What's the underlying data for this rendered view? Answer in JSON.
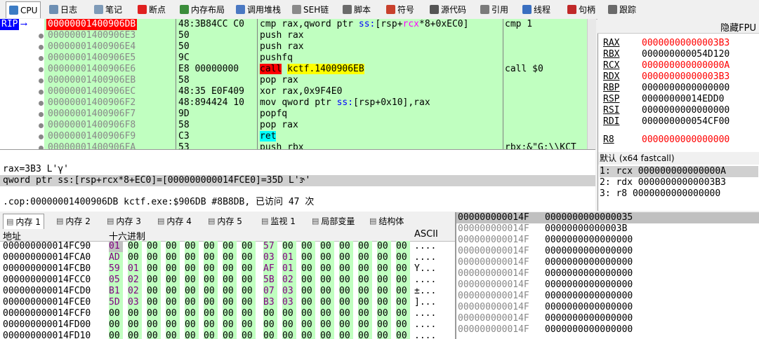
{
  "tabs": [
    {
      "label": "CPU",
      "icon": "cpu-icon",
      "color": "#3c7cc4"
    },
    {
      "label": "日志",
      "icon": "log-icon",
      "color": "#6d8fb3"
    },
    {
      "label": "笔记",
      "icon": "notes-icon",
      "color": "#7f9bb8"
    },
    {
      "label": "断点",
      "icon": "breakpoint-icon",
      "color": "#e02020"
    },
    {
      "label": "内存布局",
      "icon": "memory-map-icon",
      "color": "#3b8d3b"
    },
    {
      "label": "调用堆栈",
      "icon": "callstack-icon",
      "color": "#4a78c2"
    },
    {
      "label": "SEH链",
      "icon": "seh-icon",
      "color": "#8a8a8a"
    },
    {
      "label": "脚本",
      "icon": "script-icon",
      "color": "#6b6b6b"
    },
    {
      "label": "符号",
      "icon": "symbols-icon",
      "color": "#c8402c"
    },
    {
      "label": "源代码",
      "icon": "source-icon",
      "color": "#555555"
    },
    {
      "label": "引用",
      "icon": "references-icon",
      "color": "#7a7a7a"
    },
    {
      "label": "线程",
      "icon": "threads-icon",
      "color": "#3a6fc0"
    },
    {
      "label": "句柄",
      "icon": "handles-icon",
      "color": "#c02828"
    },
    {
      "label": "跟踪",
      "icon": "trace-icon",
      "color": "#6a6a6a"
    }
  ],
  "disasm": {
    "rip_label": "RIP",
    "rows": [
      {
        "addr": "00000001400906DB",
        "bytes": "48:3B84CC C0",
        "instr": "cmp rax,qword ptr ss:[rsp+rcx*8+0xEC0]",
        "comment": "cmp 1",
        "rip": true
      },
      {
        "addr": "00000001400906E3",
        "bytes": "50",
        "instr": "push rax",
        "comment": ""
      },
      {
        "addr": "00000001400906E4",
        "bytes": "50",
        "instr": "push rax",
        "comment": ""
      },
      {
        "addr": "00000001400906E5",
        "bytes": "9C",
        "instr": "pushfq",
        "comment": ""
      },
      {
        "addr": "00000001400906E6",
        "bytes": "E8 00000000",
        "instr": "call kctf.1400906EB",
        "comment": "call $0",
        "call": true
      },
      {
        "addr": "00000001400906EB",
        "bytes": "58",
        "instr": "pop rax",
        "comment": ""
      },
      {
        "addr": "00000001400906EC",
        "bytes": "48:35 E0F409",
        "instr": "xor rax,0x9F4E0",
        "comment": ""
      },
      {
        "addr": "00000001400906F2",
        "bytes": "48:894424 10",
        "instr": "mov qword ptr ss:[rsp+0x10],rax",
        "comment": ""
      },
      {
        "addr": "00000001400906F7",
        "bytes": "9D",
        "instr": "popfq",
        "comment": ""
      },
      {
        "addr": "00000001400906F8",
        "bytes": "58",
        "instr": "pop rax",
        "comment": ""
      },
      {
        "addr": "00000001400906F9",
        "bytes": "C3",
        "instr": "ret",
        "comment": "",
        "ret": true
      },
      {
        "addr": "00000001400906FA",
        "bytes": "53",
        "instr": "push rbx",
        "comment": "rbx:&\"G:\\\\KCT"
      }
    ]
  },
  "registers": {
    "title": "隐藏FPU",
    "items": [
      {
        "name": "RAX",
        "value": "00000000000003B3",
        "changed": true
      },
      {
        "name": "RBX",
        "value": "000000000054D120",
        "changed": false
      },
      {
        "name": "RCX",
        "value": "000000000000000A",
        "changed": true
      },
      {
        "name": "RDX",
        "value": "00000000000003B3",
        "changed": true
      },
      {
        "name": "RBP",
        "value": "0000000000000000",
        "changed": false
      },
      {
        "name": "RSP",
        "value": "00000000014EDD0",
        "changed": false
      },
      {
        "name": "RSI",
        "value": "0000000000000000",
        "changed": false
      },
      {
        "name": "RDI",
        "value": "000000000054CF00",
        "changed": false
      },
      {
        "name": "R8",
        "value": "0000000000000000",
        "changed": true
      }
    ]
  },
  "info": {
    "line1": "rax=3B3 L'γ'",
    "line2": "qword ptr ss:[rsp+rcx*8+EC0]=[000000000014FCE0]=35D L'ɝ'",
    "line3": ".cop:00000001400906DB kctf.exe:$906DB #8B8DB, 已访问 47 次"
  },
  "callconv": {
    "header": "默认 (x64 fastcall)",
    "items": [
      "1: rcx 000000000000000A",
      "2: rdx 00000000000003B3",
      "3: r8 0000000000000000"
    ]
  },
  "memtabs": [
    {
      "label": "内存 1",
      "icon": "memory-icon"
    },
    {
      "label": "内存 2",
      "icon": "memory-icon"
    },
    {
      "label": "内存 3",
      "icon": "memory-icon"
    },
    {
      "label": "内存 4",
      "icon": "memory-icon"
    },
    {
      "label": "内存 5",
      "icon": "memory-icon"
    },
    {
      "label": "监视 1",
      "icon": "watch-icon"
    },
    {
      "label": "局部变量",
      "icon": "locals-icon"
    },
    {
      "label": "结构体",
      "icon": "struct-icon"
    }
  ],
  "hexdump": {
    "col_addr": "地址",
    "col_hex": "十六进制",
    "col_ascii": "ASCII",
    "rows": [
      {
        "addr": "000000000014FC90",
        "b": [
          "01",
          "00",
          "00",
          "00",
          "00",
          "00",
          "00",
          "00",
          "57",
          "00",
          "00",
          "00",
          "00",
          "00",
          "00",
          "00"
        ],
        "ascii": "...."
      },
      {
        "addr": "000000000014FCA0",
        "b": [
          "AD",
          "00",
          "00",
          "00",
          "00",
          "00",
          "00",
          "00",
          "03",
          "01",
          "00",
          "00",
          "00",
          "00",
          "00",
          "00"
        ],
        "ascii": "...."
      },
      {
        "addr": "000000000014FCB0",
        "b": [
          "59",
          "01",
          "00",
          "00",
          "00",
          "00",
          "00",
          "00",
          "AF",
          "01",
          "00",
          "00",
          "00",
          "00",
          "00",
          "00"
        ],
        "ascii": "Y..."
      },
      {
        "addr": "000000000014FCC0",
        "b": [
          "05",
          "02",
          "00",
          "00",
          "00",
          "00",
          "00",
          "00",
          "5B",
          "02",
          "00",
          "00",
          "00",
          "00",
          "00",
          "00"
        ],
        "ascii": "...."
      },
      {
        "addr": "000000000014FCD0",
        "b": [
          "B1",
          "02",
          "00",
          "00",
          "00",
          "00",
          "00",
          "00",
          "07",
          "03",
          "00",
          "00",
          "00",
          "00",
          "00",
          "00"
        ],
        "ascii": "±..."
      },
      {
        "addr": "000000000014FCE0",
        "b": [
          "5D",
          "03",
          "00",
          "00",
          "00",
          "00",
          "00",
          "00",
          "B3",
          "03",
          "00",
          "00",
          "00",
          "00",
          "00",
          "00"
        ],
        "ascii": "]..."
      },
      {
        "addr": "000000000014FCF0",
        "b": [
          "00",
          "00",
          "00",
          "00",
          "00",
          "00",
          "00",
          "00",
          "00",
          "00",
          "00",
          "00",
          "00",
          "00",
          "00",
          "00"
        ],
        "ascii": "...."
      },
      {
        "addr": "000000000014FD00",
        "b": [
          "00",
          "00",
          "00",
          "00",
          "00",
          "00",
          "00",
          "00",
          "00",
          "00",
          "00",
          "00",
          "00",
          "00",
          "00",
          "00"
        ],
        "ascii": "...."
      },
      {
        "addr": "000000000014FD10",
        "b": [
          "00",
          "00",
          "00",
          "00",
          "00",
          "00",
          "00",
          "00",
          "00",
          "00",
          "00",
          "00",
          "00",
          "00",
          "00",
          "00"
        ],
        "ascii": "...."
      }
    ]
  },
  "stack": {
    "rows": [
      {
        "addr": "000000000014F",
        "val": "0000000000000035",
        "top": true
      },
      {
        "addr": "000000000014F",
        "val": "00000000000003B"
      },
      {
        "addr": "000000000014F",
        "val": "0000000000000000"
      },
      {
        "addr": "000000000014F",
        "val": "0000000000000000"
      },
      {
        "addr": "000000000014F",
        "val": "0000000000000000"
      },
      {
        "addr": "000000000014F",
        "val": "0000000000000000"
      },
      {
        "addr": "000000000014F",
        "val": "0000000000000000"
      },
      {
        "addr": "000000000014F",
        "val": "0000000000000000"
      },
      {
        "addr": "000000000014F",
        "val": "0000000000000000"
      },
      {
        "addr": "000000000014F",
        "val": "0000000000000000"
      },
      {
        "addr": "000000000014F",
        "val": "0000000000000000"
      }
    ]
  },
  "colors": {
    "rip_bg": "#ff0000",
    "rip_text": "#ffffff",
    "disasm_green": "#c0ffc0",
    "changed_reg": "#ff0000",
    "call_bg": "#ff0000",
    "call_target_bg": "#ffff00",
    "ret_bg": "#00ffff",
    "hex_green": "#c0ffc0",
    "stack_top_bg": "#c0c0c0"
  }
}
